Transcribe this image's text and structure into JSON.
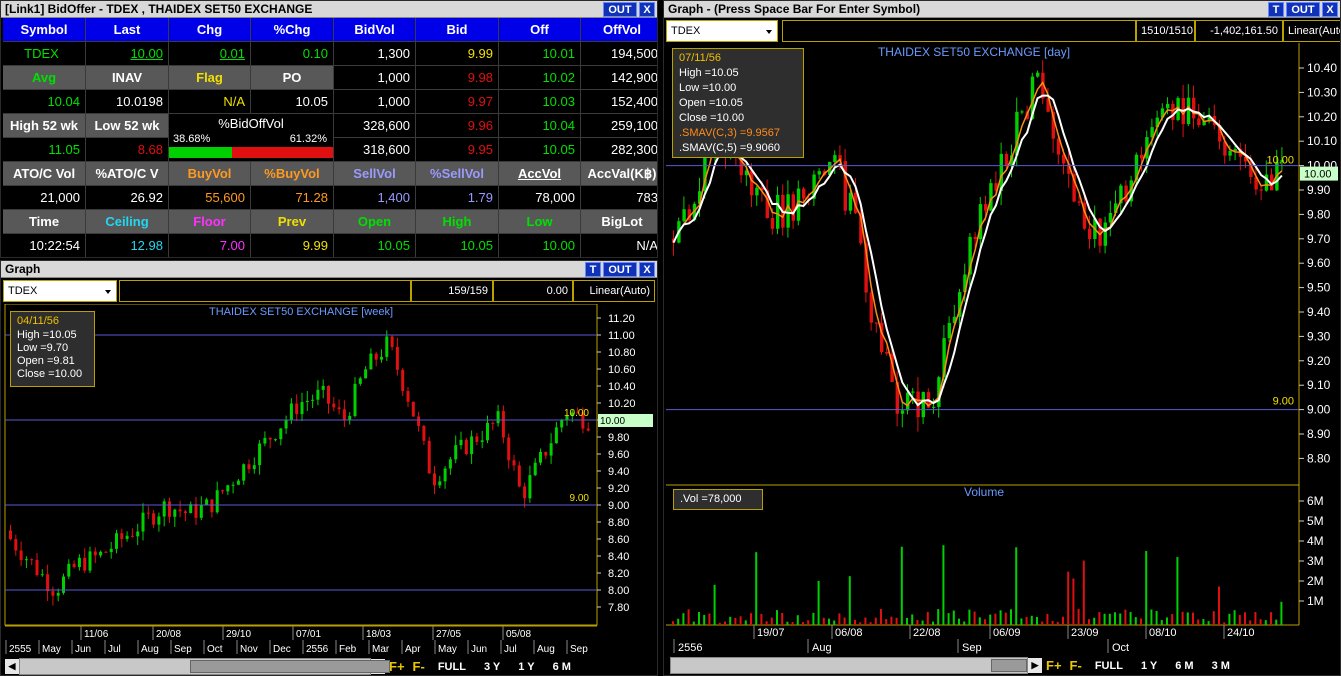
{
  "bidoffer": {
    "title": "[Link1] BidOffer - TDEX , THAIDEX SET50 EXCHANGE",
    "out": "OUT",
    "close": "X",
    "header": [
      "Symbol",
      "Last",
      "Chg",
      "%Chg",
      "BidVol",
      "Bid",
      "Off",
      "OffVol"
    ],
    "r1": [
      "TDEX",
      "10.00",
      "0.01",
      "0.10",
      "1,300",
      "9.99",
      "10.01",
      "194,500"
    ],
    "r2": [
      "Avg",
      "INAV",
      "Flag",
      "PO",
      "1,000",
      "9.98",
      "10.02",
      "142,900"
    ],
    "r3": [
      "10.04",
      "10.0198",
      "N/A",
      "10.05",
      "1,000",
      "9.97",
      "10.03",
      "152,400"
    ],
    "r4": [
      "High 52 wk",
      "Low 52 wk",
      "%BidOffVol",
      "38.68%",
      "61.32%",
      "328,600",
      "9.96",
      "10.04",
      "259,100"
    ],
    "r5": [
      "11.05",
      "8.68",
      "318,600",
      "9.95",
      "10.05",
      "282,300"
    ],
    "r6": [
      "ATO/C Vol",
      "%ATO/C V",
      "BuyVol",
      "%BuyVol",
      "SellVol",
      "%SellVol",
      "AccVol",
      "AccVal(K฿)"
    ],
    "r7": [
      "21,000",
      "26.92",
      "55,600",
      "71.28",
      "1,400",
      "1.79",
      "78,000",
      "783"
    ],
    "r8": [
      "Time",
      "Ceiling",
      "Floor",
      "Prev",
      "Open",
      "High",
      "Low",
      "BigLot"
    ],
    "r9": [
      "10:22:54",
      "12.98",
      "7.00",
      "9.99",
      "10.05",
      "10.05",
      "10.00",
      "N/A"
    ],
    "bid_pct": 0.3868
  },
  "graph_week": {
    "title": "Graph",
    "out": "OUT",
    "close": "X",
    "t": "T",
    "symbol": "TDEX",
    "counter": "159/159",
    "value": "0.00",
    "scale": "Linear(Auto)",
    "chart_title": "THAIDEX SET50 EXCHANGE [week]",
    "info": {
      "date": "04/11/56",
      "high": "High  =10.05",
      "low": "Low   =9.70",
      "open": "Open  =9.81",
      "close": "Close  =10.00"
    },
    "y_ticks": [
      "11.20",
      "11.00",
      "10.80",
      "10.60",
      "10.40",
      "10.20",
      "10.00",
      "9.80",
      "9.60",
      "9.40",
      "9.20",
      "9.00",
      "8.80",
      "8.60",
      "8.40",
      "8.20",
      "8.00",
      "7.80"
    ],
    "tag_current": "10.00",
    "tag_level_high": "10.00",
    "tag_level_low": "9.00",
    "x_dates": [
      "11/06",
      "20/08",
      "29/10",
      "07/01",
      "18/03",
      "27/05",
      "05/08"
    ],
    "x_months": [
      "2555",
      "May",
      "Jun",
      "Jul",
      "Aug",
      "Sep",
      "Oct",
      "Nov",
      "Dec",
      "2556",
      "Feb",
      "Mar",
      "Apr",
      "May",
      "Jun",
      "Jul",
      "Aug",
      "Sep"
    ],
    "timeframes": [
      "FULL",
      "3 Y",
      "1 Y",
      "6 M"
    ]
  },
  "graph_day": {
    "title": "Graph - (Press Space Bar For Enter Symbol)",
    "out": "OUT",
    "close": "X",
    "t": "T",
    "symbol": "TDEX",
    "counter": "1510/1510",
    "value": "-1,402,161.50",
    "scale": "Linear(Auto)",
    "chart_title": "THAIDEX SET50 EXCHANGE [day]",
    "info": {
      "date": "07/11/56",
      "high": "High  =10.05",
      "low": "Low   =10.00",
      "open": "Open  =10.05",
      "close": "Close  =10.00",
      "sma3": ".SMAV(C,3)  =9.9567",
      "sma5": ".SMAV(C,5)  =9.9060"
    },
    "y_ticks": [
      "10.40",
      "10.30",
      "10.20",
      "10.10",
      "10.00",
      "9.90",
      "9.80",
      "9.70",
      "9.60",
      "9.50",
      "9.40",
      "9.30",
      "9.20",
      "9.10",
      "9.00",
      "8.90",
      "8.80"
    ],
    "tag_current": "10.00",
    "tag_level_high": "10.00",
    "tag_level_low": "9.00",
    "volume_title": "Volume",
    "volume_info": ".Vol    =78,000",
    "vol_ticks": [
      "6M",
      "5M",
      "4M",
      "3M",
      "2M",
      "1M"
    ],
    "x_dates": [
      "19/07",
      "06/08",
      "22/08",
      "06/09",
      "23/09",
      "08/10",
      "24/10"
    ],
    "x_months": [
      "2556",
      "Aug",
      "Sep",
      "Oct"
    ],
    "timeframes": [
      "FULL",
      "1 Y",
      "6 M",
      "3 M"
    ]
  },
  "fplus": "F+",
  "fminus": "F-",
  "colors": {
    "up": "#00d000",
    "down": "#e01010",
    "sma3": "#ff8c1a",
    "sma5": "#ffffff",
    "title": "#6a9bff",
    "level": "#5a5ad8"
  }
}
